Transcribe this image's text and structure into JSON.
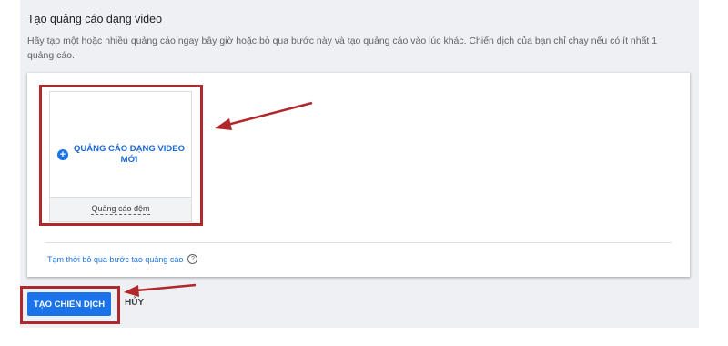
{
  "section": {
    "title": "Tạo quảng cáo dạng video",
    "description": "Hãy tạo một hoặc nhiều quảng cáo ngay bây giờ hoặc bỏ qua bước này và tạo quảng cáo vào lúc khác. Chiến dịch của bạn chỉ chạy nếu có ít nhất 1 quảng cáo."
  },
  "ad_tile": {
    "label": "QUẢNG CÁO DẠNG VIDEO MỚI",
    "footer": "Quảng cáo đệm",
    "icon": "plus-circle-icon"
  },
  "skip": {
    "label": "Tạm thời bỏ qua bước tạo quảng cáo",
    "icon": "help-circle-icon"
  },
  "actions": {
    "create_label": "TẠO CHIẾN DỊCH",
    "cancel_label": "HỦY"
  },
  "colors": {
    "accent": "#1a73e8",
    "annotation": "#b0282b",
    "panel_bg": "#eef0f3"
  }
}
